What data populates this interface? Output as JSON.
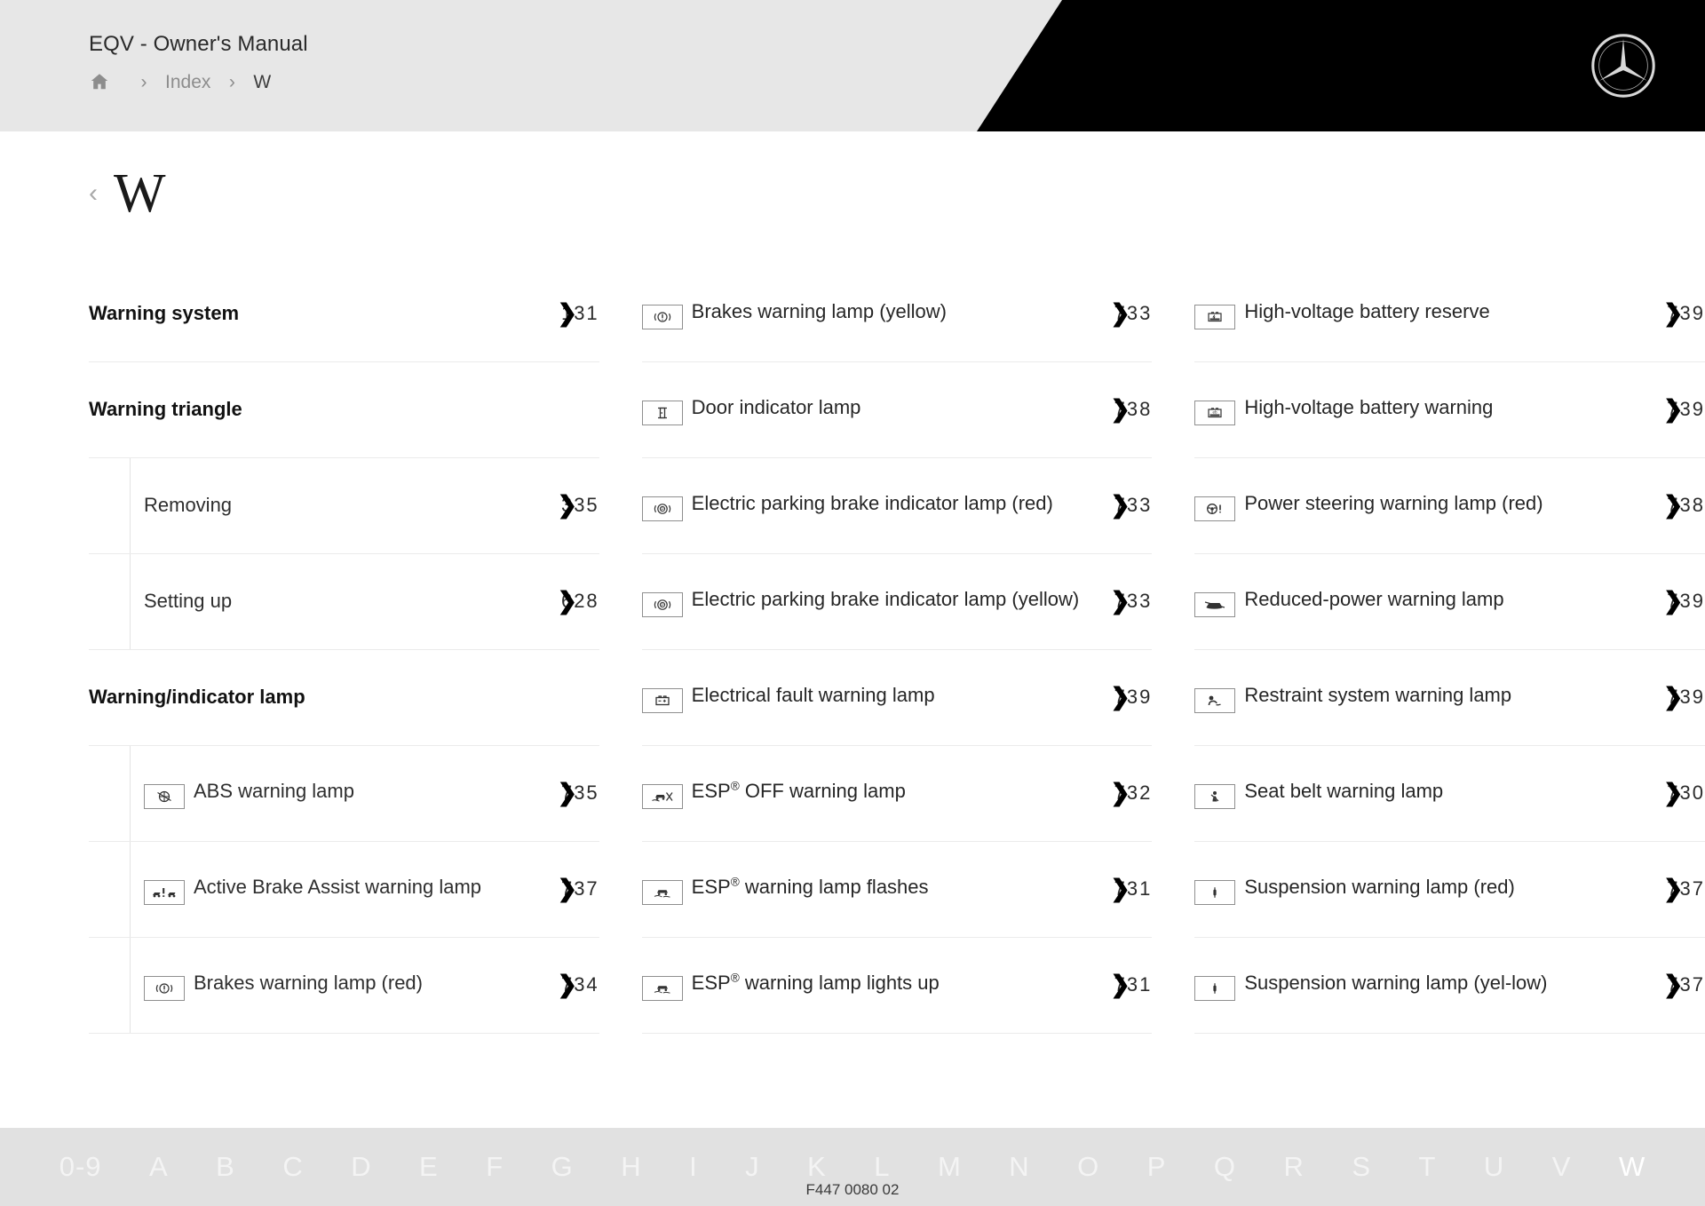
{
  "header": {
    "title": "EQV - Owner's Manual",
    "breadcrumb": {
      "home_icon": "home-icon",
      "separator": "›",
      "items": [
        "Index",
        "W"
      ]
    },
    "logo": "mercedes-benz-star-logo"
  },
  "letter_heading": {
    "back": "‹",
    "letter": "W"
  },
  "page_chevron": "❯",
  "columns": [
    {
      "entries": [
        {
          "label": "Warning system",
          "page": "131",
          "level": "top",
          "icon": null
        },
        {
          "label": "Warning triangle",
          "page": "",
          "level": "top",
          "icon": null
        },
        {
          "label": "Removing",
          "page": "335",
          "level": "sub",
          "icon": null
        },
        {
          "label": "Setting up",
          "page": "628",
          "level": "sub",
          "icon": null
        },
        {
          "label": "Warning/indicator lamp",
          "page": "",
          "level": "top",
          "icon": null
        },
        {
          "label": "ABS warning lamp",
          "page": "735",
          "level": "sub",
          "icon": "abs-lamp-icon"
        },
        {
          "label": "Active Brake Assist warning lamp",
          "page": "737",
          "level": "sub",
          "icon": "active-brake-assist-icon"
        },
        {
          "label": "Brakes warning lamp (red)",
          "page": "734",
          "level": "sub",
          "icon": "brakes-lamp-icon"
        }
      ]
    },
    {
      "entries": [
        {
          "label": "Brakes warning lamp (yellow)",
          "page": "733",
          "level": "item",
          "icon": "brakes-lamp-icon"
        },
        {
          "label": "Door indicator lamp",
          "page": "738",
          "level": "item",
          "icon": "door-indicator-icon"
        },
        {
          "label": "Electric parking brake indicator lamp (red)",
          "page": "733",
          "level": "item",
          "icon": "parking-brake-icon"
        },
        {
          "label": "Electric parking brake indicator lamp (yellow)",
          "page": "733",
          "level": "item",
          "icon": "parking-brake-icon"
        },
        {
          "label": "Electrical fault warning lamp",
          "page": "739",
          "level": "item",
          "icon": "battery-fault-icon"
        },
        {
          "label": "ESP® OFF warning lamp",
          "page": "732",
          "level": "item",
          "icon": "esp-off-icon"
        },
        {
          "label": "ESP® warning lamp flashes",
          "page": "731",
          "level": "item",
          "icon": "esp-icon"
        },
        {
          "label": "ESP® warning lamp lights up",
          "page": "731",
          "level": "item",
          "icon": "esp-icon"
        }
      ]
    },
    {
      "entries": [
        {
          "label": "High-voltage battery reserve",
          "page": "739",
          "level": "item",
          "icon": "hv-battery-reserve-icon"
        },
        {
          "label": "High-voltage battery warning",
          "page": "739",
          "level": "item",
          "icon": "hv-battery-warning-icon"
        },
        {
          "label": "Power steering warning lamp (red)",
          "page": "738",
          "level": "item",
          "icon": "power-steering-icon"
        },
        {
          "label": "Reduced-power warning lamp",
          "page": "739",
          "level": "item",
          "icon": "reduced-power-icon"
        },
        {
          "label": "Restraint system warning lamp",
          "page": "739",
          "level": "item",
          "icon": "restraint-system-icon"
        },
        {
          "label": "Seat belt warning lamp",
          "page": "730",
          "level": "item",
          "icon": "seat-belt-icon"
        },
        {
          "label": "Suspension warning lamp (red)",
          "page": "737",
          "level": "item",
          "icon": "suspension-icon"
        },
        {
          "label": "Suspension warning lamp (yel-low)",
          "page": "737",
          "level": "item",
          "icon": "suspension-icon"
        }
      ]
    }
  ],
  "alphabet_bar": {
    "letters": [
      "0-9",
      "A",
      "B",
      "C",
      "D",
      "E",
      "F",
      "G",
      "H",
      "I",
      "J",
      "K",
      "L",
      "M",
      "N",
      "O",
      "P",
      "Q",
      "R",
      "S",
      "T",
      "U",
      "V",
      "W"
    ],
    "active": "W"
  },
  "document_code": "F447 0080 02",
  "colors": {
    "header_bg": "#e7e7e7",
    "header_black": "#000000",
    "alpha_bar": "#e1e1e1",
    "text": "#262626",
    "muted": "#8d8d8d",
    "divider": "#ebebeb"
  }
}
